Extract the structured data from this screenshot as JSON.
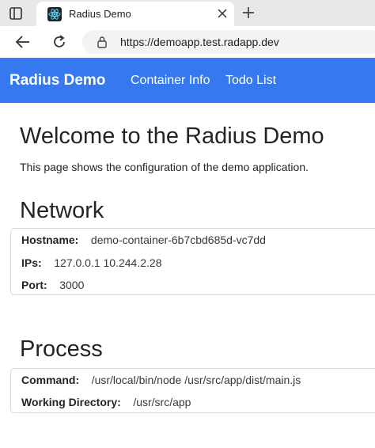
{
  "browser": {
    "tab_title": "Radius Demo",
    "url": "https://demoapp.test.radapp.dev"
  },
  "navbar": {
    "brand": "Radius Demo",
    "links": [
      "Container Info",
      "Todo List"
    ]
  },
  "main": {
    "title": "Welcome to the Radius Demo",
    "description": "This page shows the configuration of the demo application."
  },
  "network": {
    "heading": "Network",
    "rows": [
      {
        "label": "Hostname:",
        "value": "demo-container-6b7cbd685d-vc7dd"
      },
      {
        "label": "IPs:",
        "value": "127.0.0.1 10.244.2.28"
      },
      {
        "label": "Port:",
        "value": "3000"
      }
    ]
  },
  "process": {
    "heading": "Process",
    "rows": [
      {
        "label": "Command:",
        "value": "/usr/local/bin/node /usr/src/app/dist/main.js"
      },
      {
        "label": "Working Directory:",
        "value": "/usr/src/app"
      }
    ]
  },
  "colors": {
    "navbar": "#3578f0",
    "text": "#212529"
  }
}
